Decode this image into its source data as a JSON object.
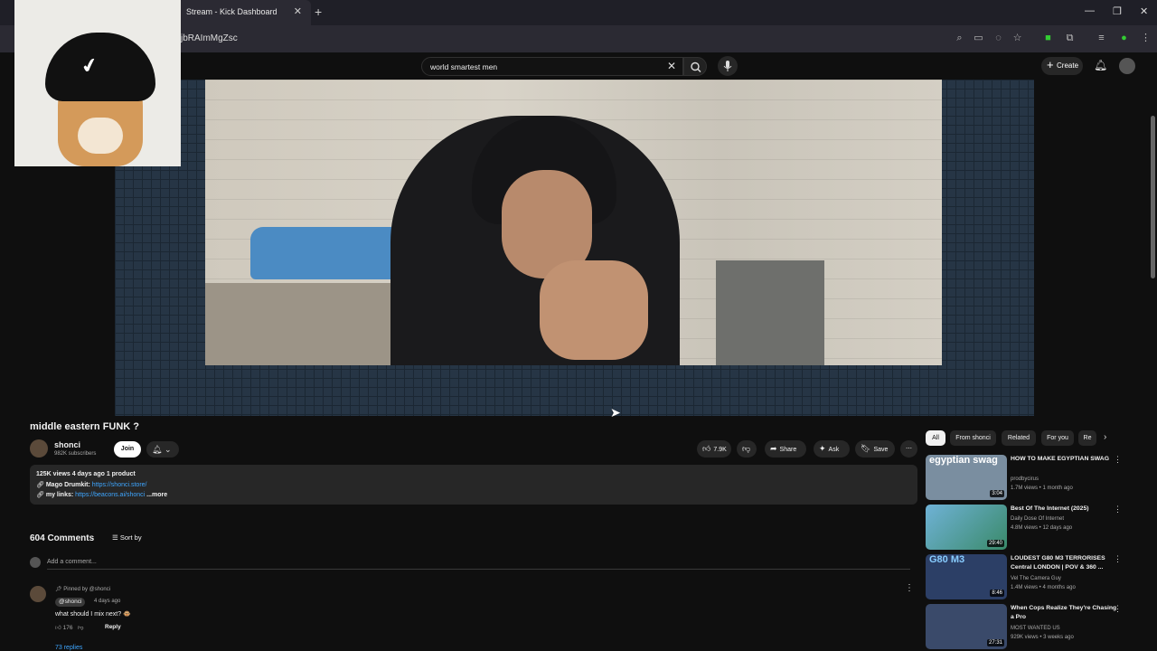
{
  "browser": {
    "tab_title": "Stream - Kick Dashboard",
    "url_fragment": "jbRAImMgZsc"
  },
  "header": {
    "search_value": "world smartest men",
    "create_label": "Create"
  },
  "video": {
    "title": "middle eastern FUNK ?",
    "channel": "shonci",
    "subscribers": "982K subscribers",
    "join_label": "Join",
    "likes": "7.9K",
    "share_label": "Share",
    "ask_label": "Ask",
    "save_label": "Save"
  },
  "description": {
    "stats": "125K views  4 days ago  1 product",
    "line1_label": "Mago Drumkit: ",
    "line1_link": "https://shonci.store/",
    "line2_label": "my links: ",
    "line2_link": "https://beacons.ai/shonci",
    "more": "...more"
  },
  "comments": {
    "count": "604 Comments",
    "sort_label": "Sort by",
    "add_placeholder": "Add a comment...",
    "pinned": "Pinned by @shonci",
    "author": "@shonci",
    "time": "4 days ago",
    "text": "what should I mix next? 🐵",
    "likes": "176",
    "reply_label": "Reply",
    "replies": "73 replies"
  },
  "chips": [
    "All",
    "From shonci",
    "Related",
    "For you",
    "Re"
  ],
  "recommendations": [
    {
      "title": "HOW TO MAKE EGYPTIAN SWAG",
      "channel": "prodbycirus",
      "views": "1.7M views • 1 month ago",
      "duration": "3:04",
      "thumb_text": "egyptian swag",
      "color": "#7a8ea0"
    },
    {
      "title": "Best Of The Internet (2025)",
      "channel": "Daily Dose Of Internet",
      "views": "4.8M views • 12 days ago",
      "duration": "29:40",
      "thumb_text": "",
      "color": "#3f8fb0"
    },
    {
      "title": "LOUDEST G80 M3 TERRORISES Central LONDON | POV & 360 ...",
      "channel": "Vel The Camera Guy",
      "views": "1.4M views • 4 months ago",
      "duration": "8:46",
      "thumb_text": "G80 M3",
      "color": "#2c3f66"
    },
    {
      "title": "When Cops Realize They're Chasing a Pro",
      "channel": "MOST WANTED US",
      "views": "929K views • 3 weeks ago",
      "duration": "27:31",
      "thumb_text": "",
      "color": "#3a4a6a"
    }
  ]
}
